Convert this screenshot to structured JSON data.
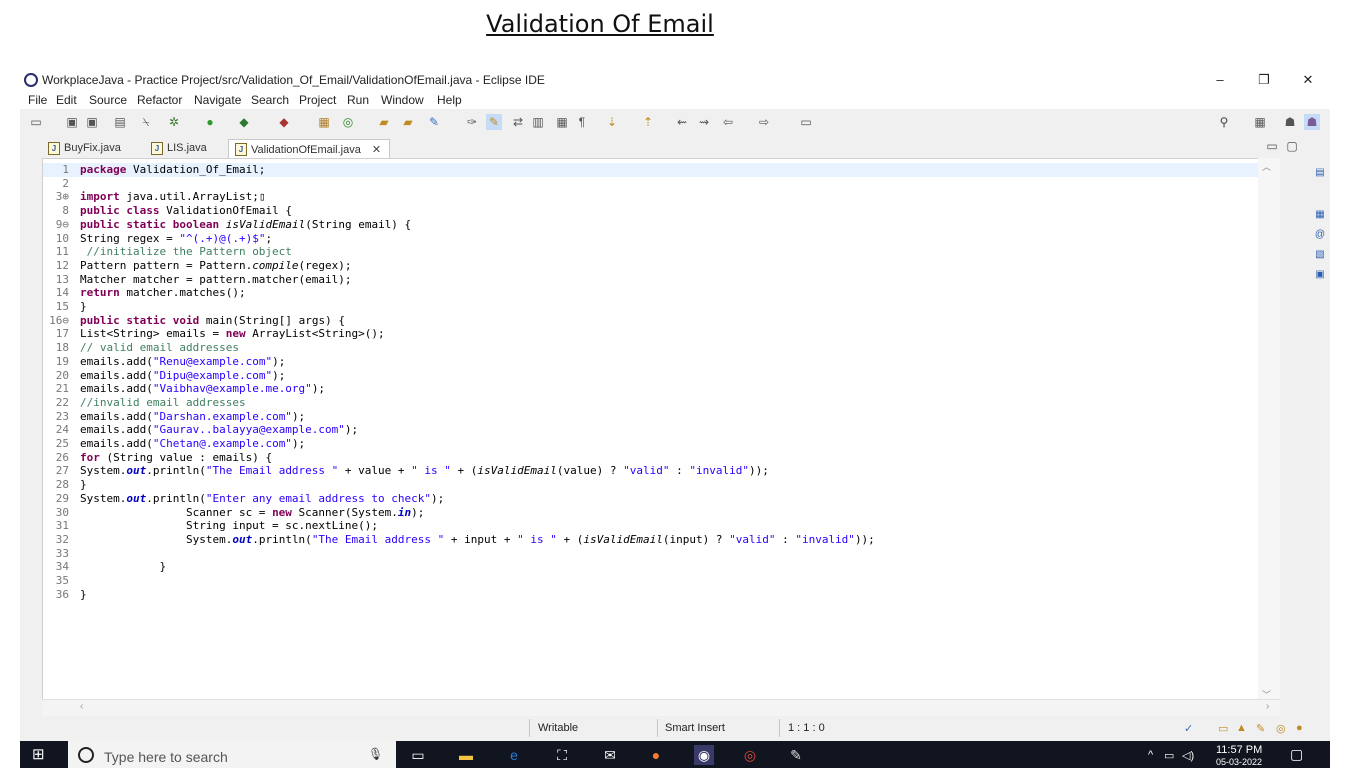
{
  "doc_title": "Validation Of Email",
  "window": {
    "title": "WorkplaceJava - Practice Project/src/Validation_Of_Email/ValidationOfEmail.java - Eclipse IDE",
    "minimize": "–",
    "maximize": "❐",
    "close": "✕"
  },
  "menu": [
    "File",
    "Edit",
    "Source",
    "Refactor",
    "Navigate",
    "Search",
    "Project",
    "Run",
    "Window",
    "Help"
  ],
  "tabs": [
    {
      "label": "BuyFix.java"
    },
    {
      "label": "LIS.java"
    },
    {
      "label": "ValidationOfEmail.java",
      "active": true,
      "close": "✕"
    }
  ],
  "code_lines": [
    {
      "n": "1",
      "text": "package Validation_Of_Email;"
    },
    {
      "n": "2",
      "text": ""
    },
    {
      "n": "3⊕",
      "text": "import java.util.ArrayList;▯"
    },
    {
      "n": "8",
      "text": "public class ValidationOfEmail {"
    },
    {
      "n": "9⊖",
      "text": "public static boolean isValidEmail(String email) {"
    },
    {
      "n": "10",
      "text": "String regex = \"^(.+)@(.+)$\";"
    },
    {
      "n": "11",
      "text": " //initialize the Pattern object"
    },
    {
      "n": "12",
      "text": "Pattern pattern = Pattern.compile(regex);"
    },
    {
      "n": "13",
      "text": "Matcher matcher = pattern.matcher(email);"
    },
    {
      "n": "14",
      "text": "return matcher.matches();"
    },
    {
      "n": "15",
      "text": "}"
    },
    {
      "n": "16⊖",
      "text": "public static void main(String[] args) {"
    },
    {
      "n": "17",
      "text": "List<String> emails = new ArrayList<String>();"
    },
    {
      "n": "18",
      "text": "// valid email addresses"
    },
    {
      "n": "19",
      "text": "emails.add(\"Renu@example.com\");"
    },
    {
      "n": "20",
      "text": "emails.add(\"Dipu@example.com\");"
    },
    {
      "n": "21",
      "text": "emails.add(\"Vaibhav@example.me.org\");"
    },
    {
      "n": "22",
      "text": "//invalid email addresses"
    },
    {
      "n": "23",
      "text": "emails.add(\"Darshan.example.com\");"
    },
    {
      "n": "24",
      "text": "emails.add(\"Gaurav..balayya@example.com\");"
    },
    {
      "n": "25",
      "text": "emails.add(\"Chetan@.example.com\");"
    },
    {
      "n": "26",
      "text": "for (String value : emails) {"
    },
    {
      "n": "27",
      "text": "System.out.println(\"The Email address \" + value + \" is \" + (isValidEmail(value) ? \"valid\" : \"invalid\"));"
    },
    {
      "n": "28",
      "text": "}"
    },
    {
      "n": "29",
      "text": "System.out.println(\"Enter any email address to check\");"
    },
    {
      "n": "30",
      "text": "                Scanner sc = new Scanner(System.in);"
    },
    {
      "n": "31",
      "text": "                String input = sc.nextLine();"
    },
    {
      "n": "32",
      "text": "                System.out.println(\"The Email address \" + input + \" is \" + (isValidEmail(input) ? \"valid\" : \"invalid\"));"
    },
    {
      "n": "33",
      "text": ""
    },
    {
      "n": "34",
      "text": "            }"
    },
    {
      "n": "35",
      "text": ""
    },
    {
      "n": "36",
      "text": "}"
    }
  ],
  "status": {
    "writable": "Writable",
    "insert_mode": "Smart Insert",
    "position": "1 : 1 : 0"
  },
  "taskbar": {
    "search_placeholder": "Type here to search",
    "time": "11:57 PM",
    "date": "05-03-2022"
  }
}
